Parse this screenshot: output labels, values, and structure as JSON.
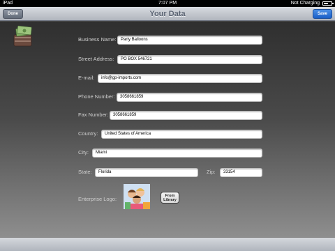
{
  "status_bar": {
    "device": "iPad",
    "time": "7:07 PM",
    "battery_status": "Not Charging",
    "battery_level": 0.6
  },
  "nav_bar": {
    "title": "Your Data",
    "done_label": "Done",
    "save_label": "Save"
  },
  "form": {
    "business_name": {
      "label": "Business Name:",
      "value": "Party Balloons"
    },
    "street_address": {
      "label": "Street Address:",
      "value": "PO BOX 546721"
    },
    "email": {
      "label": "E-mail:",
      "value": "info@gp-imports.com"
    },
    "phone": {
      "label": "Phone Number:",
      "value": "3058661859"
    },
    "fax": {
      "label": "Fax Number:",
      "value": "3058661859"
    },
    "country": {
      "label": "Country:",
      "value": "United States of America"
    },
    "city": {
      "label": "City:",
      "value": "Miami"
    },
    "state": {
      "label": "State:",
      "value": "Florida"
    },
    "zip": {
      "label": "Zip:",
      "value": "33154"
    },
    "logo": {
      "label": "Enterprise Logo:",
      "library_button": "From Library"
    }
  },
  "colors": {
    "nav_title": "#5a6372",
    "save_button": "#1a5fc7",
    "label_text": "#cfcfcf"
  }
}
